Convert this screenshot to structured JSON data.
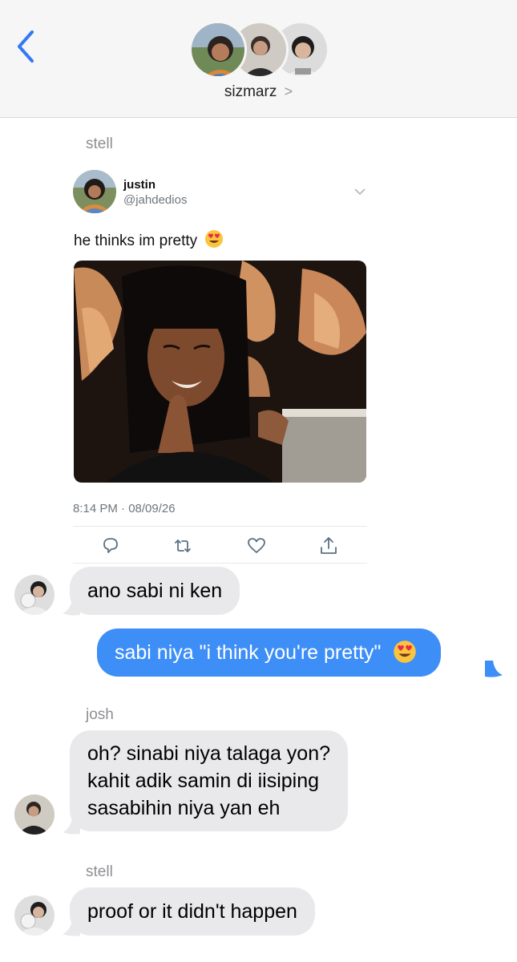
{
  "header": {
    "group_name": "sizmarz",
    "chevron": ">"
  },
  "tweet_share": {
    "sender": "stell",
    "author_name": "justin",
    "author_handle": "@jahdedios",
    "text": "he thinks im pretty",
    "text_emoji": "heart-eyes-emoji",
    "timestamp": "8:14 PM · 08/09/26",
    "image_description_icon": "photo"
  },
  "messages": [
    {
      "text": "ano sabi ni ken"
    },
    {
      "text": "sabi niya \"i think you're pretty\"",
      "emoji": "heart-eyes-emoji"
    },
    {
      "sender": "josh",
      "lines": [
        "oh? sinabi niya talaga yon?",
        "kahit adik samin di iisiping",
        "sasabihin niya yan eh"
      ]
    },
    {
      "sender": "stell",
      "text": "proof or it didn't happen"
    }
  ],
  "colors": {
    "outgoing_bubble": "#3d8ef7",
    "incoming_bubble": "#e9e9eb",
    "back_arrow": "#3478f6"
  }
}
